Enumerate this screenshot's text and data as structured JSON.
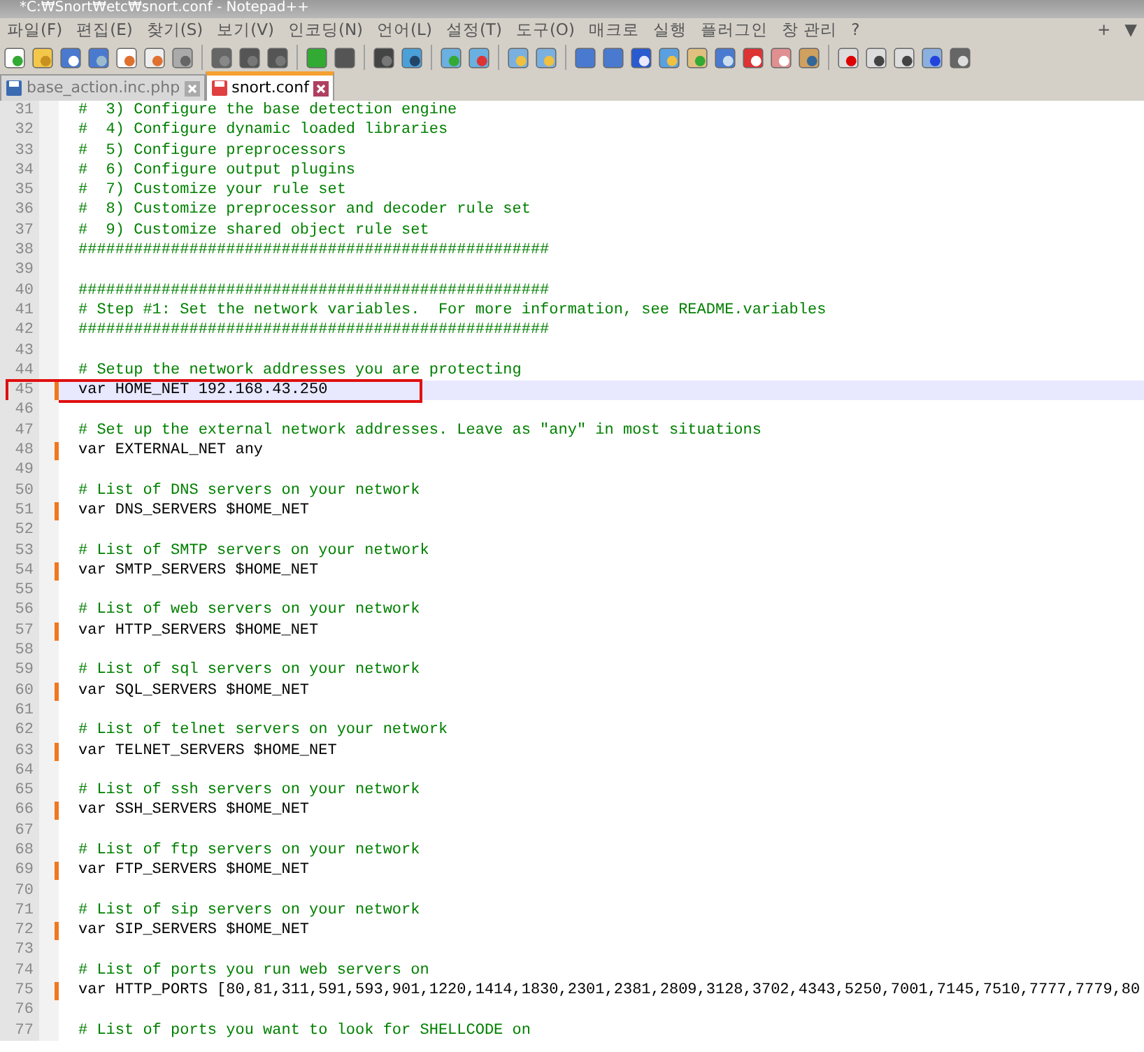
{
  "window": {
    "title": "*C:₩Snort₩etc₩snort.conf - Notepad++"
  },
  "menu": [
    "파일(F)",
    "편집(E)",
    "찾기(S)",
    "보기(V)",
    "인코딩(N)",
    "언어(L)",
    "설정(T)",
    "도구(O)",
    "매크로",
    "실행",
    "플러그인",
    "창 관리",
    "?"
  ],
  "menu_right": [
    "+",
    "▼"
  ],
  "tabs": [
    {
      "label": "base_action.inc.php",
      "selected": false,
      "modified": false
    },
    {
      "label": "snort.conf",
      "selected": true,
      "modified": true
    }
  ],
  "lines": [
    {
      "number": "31",
      "kind": "comment",
      "text": "#  3) Configure the base detection engine",
      "changed": false,
      "current": false,
      "marked": false
    },
    {
      "number": "32",
      "kind": "comment",
      "text": "#  4) Configure dynamic loaded libraries",
      "changed": false,
      "current": false,
      "marked": false
    },
    {
      "number": "33",
      "kind": "comment",
      "text": "#  5) Configure preprocessors",
      "changed": false,
      "current": false,
      "marked": false
    },
    {
      "number": "34",
      "kind": "comment",
      "text": "#  6) Configure output plugins",
      "changed": false,
      "current": false,
      "marked": false
    },
    {
      "number": "35",
      "kind": "comment",
      "text": "#  7) Customize your rule set",
      "changed": false,
      "current": false,
      "marked": false
    },
    {
      "number": "36",
      "kind": "comment",
      "text": "#  8) Customize preprocessor and decoder rule set",
      "changed": false,
      "current": false,
      "marked": false
    },
    {
      "number": "37",
      "kind": "comment",
      "text": "#  9) Customize shared object rule set",
      "changed": false,
      "current": false,
      "marked": false
    },
    {
      "number": "38",
      "kind": "comment",
      "text": "###################################################",
      "changed": false,
      "current": false,
      "marked": false
    },
    {
      "number": "39",
      "kind": "blank",
      "changed": false,
      "current": false,
      "marked": false
    },
    {
      "number": "40",
      "kind": "comment",
      "text": "###################################################",
      "changed": false,
      "current": false,
      "marked": false
    },
    {
      "number": "41",
      "kind": "comment",
      "text": "# Step #1: Set the network variables.  For more information, see README.variables",
      "changed": false,
      "current": false,
      "marked": false
    },
    {
      "number": "42",
      "kind": "comment",
      "text": "###################################################",
      "changed": false,
      "current": false,
      "marked": false
    },
    {
      "number": "43",
      "kind": "blank",
      "changed": false,
      "current": false,
      "marked": false
    },
    {
      "number": "44",
      "kind": "comment",
      "text": "# Setup the network addresses you are protecting",
      "changed": false,
      "current": false,
      "marked": false
    },
    {
      "number": "45",
      "kind": "code",
      "text": "var HOME_NET 192.168.43.250",
      "changed": true,
      "current": true,
      "marked": true
    },
    {
      "number": "46",
      "kind": "blank",
      "changed": false,
      "current": false,
      "marked": false
    },
    {
      "number": "47",
      "kind": "comment",
      "text": "# Set up the external network addresses. Leave as \"any\" in most situations",
      "changed": false,
      "current": false,
      "marked": false
    },
    {
      "number": "48",
      "kind": "code",
      "text": "var EXTERNAL_NET any",
      "changed": true,
      "current": false,
      "marked": false
    },
    {
      "number": "49",
      "kind": "blank",
      "changed": false,
      "current": false,
      "marked": false
    },
    {
      "number": "50",
      "kind": "comment",
      "text": "# List of DNS servers on your network",
      "changed": false,
      "current": false,
      "marked": false
    },
    {
      "number": "51",
      "kind": "code",
      "text": "var DNS_SERVERS $HOME_NET",
      "changed": true,
      "current": false,
      "marked": false
    },
    {
      "number": "52",
      "kind": "blank",
      "changed": false,
      "current": false,
      "marked": false
    },
    {
      "number": "53",
      "kind": "comment",
      "text": "# List of SMTP servers on your network",
      "changed": false,
      "current": false,
      "marked": false
    },
    {
      "number": "54",
      "kind": "code",
      "text": "var SMTP_SERVERS $HOME_NET",
      "changed": true,
      "current": false,
      "marked": false
    },
    {
      "number": "55",
      "kind": "blank",
      "changed": false,
      "current": false,
      "marked": false
    },
    {
      "number": "56",
      "kind": "comment",
      "text": "# List of web servers on your network",
      "changed": false,
      "current": false,
      "marked": false
    },
    {
      "number": "57",
      "kind": "code",
      "text": "var HTTP_SERVERS $HOME_NET",
      "changed": true,
      "current": false,
      "marked": false
    },
    {
      "number": "58",
      "kind": "blank",
      "changed": false,
      "current": false,
      "marked": false
    },
    {
      "number": "59",
      "kind": "comment",
      "text": "# List of sql servers on your network",
      "changed": false,
      "current": false,
      "marked": false
    },
    {
      "number": "60",
      "kind": "code",
      "text": "var SQL_SERVERS $HOME_NET",
      "changed": true,
      "current": false,
      "marked": false
    },
    {
      "number": "61",
      "kind": "blank",
      "changed": false,
      "current": false,
      "marked": false
    },
    {
      "number": "62",
      "kind": "comment",
      "text": "# List of telnet servers on your network",
      "changed": false,
      "current": false,
      "marked": false
    },
    {
      "number": "63",
      "kind": "code",
      "text": "var TELNET_SERVERS $HOME_NET",
      "changed": true,
      "current": false,
      "marked": false
    },
    {
      "number": "64",
      "kind": "blank",
      "changed": false,
      "current": false,
      "marked": false
    },
    {
      "number": "65",
      "kind": "comment",
      "text": "# List of ssh servers on your network",
      "changed": false,
      "current": false,
      "marked": false
    },
    {
      "number": "66",
      "kind": "code",
      "text": "var SSH_SERVERS $HOME_NET",
      "changed": true,
      "current": false,
      "marked": false
    },
    {
      "number": "67",
      "kind": "blank",
      "changed": false,
      "current": false,
      "marked": false
    },
    {
      "number": "68",
      "kind": "comment",
      "text": "# List of ftp servers on your network",
      "changed": false,
      "current": false,
      "marked": false
    },
    {
      "number": "69",
      "kind": "code",
      "text": "var FTP_SERVERS $HOME_NET",
      "changed": true,
      "current": false,
      "marked": false
    },
    {
      "number": "70",
      "kind": "blank",
      "changed": false,
      "current": false,
      "marked": false
    },
    {
      "number": "71",
      "kind": "comment",
      "text": "# List of sip servers on your network",
      "changed": false,
      "current": false,
      "marked": false
    },
    {
      "number": "72",
      "kind": "code",
      "text": "var SIP_SERVERS $HOME_NET",
      "changed": true,
      "current": false,
      "marked": false
    },
    {
      "number": "73",
      "kind": "blank",
      "changed": false,
      "current": false,
      "marked": false
    },
    {
      "number": "74",
      "kind": "comment",
      "text": "# List of ports you run web servers on",
      "changed": false,
      "current": false,
      "marked": false
    },
    {
      "number": "75",
      "kind": "code",
      "text": "var HTTP_PORTS [80,81,311,591,593,901,1220,1414,1830,2301,2381,2809,3128,3702,4343,5250,7001,7145,7510,7777,7779,80",
      "changed": true,
      "current": false,
      "marked": false
    },
    {
      "number": "76",
      "kind": "blank",
      "changed": false,
      "current": false,
      "marked": false
    },
    {
      "number": "77",
      "kind": "comment",
      "text": "# List of ports you want to look for SHELLCODE on",
      "changed": false,
      "current": false,
      "marked": false
    }
  ]
}
